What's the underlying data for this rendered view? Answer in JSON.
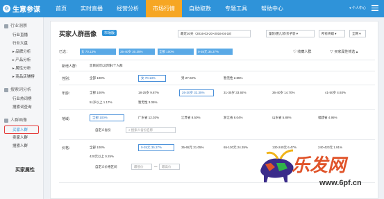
{
  "app": {
    "logo": "生意参谋"
  },
  "nav": [
    "首页",
    "实时直播",
    "经营分析",
    "市场行情",
    "自助取数",
    "专题工具",
    "帮助中心"
  ],
  "user": "个人中心",
  "sidebar": {
    "sections": [
      {
        "title": "行业洞察",
        "items": [
          "行业直播",
          "行业大盘",
          "品牌分析",
          "产品分析",
          "属性分析",
          "商品店铺榜"
        ]
      },
      {
        "title": "搜索词分析",
        "items": [
          "行业热词榜",
          "搜索词查询"
        ]
      },
      {
        "title": "人群画像",
        "items": [
          "买家人群",
          "卖家人群",
          "搜索人群"
        ]
      }
    ],
    "active": "买家人群"
  },
  "page": {
    "title": "买家人群画像",
    "badge": "市场版",
    "date_range": "最近30天（2016-03-20~2016-04-18）",
    "category": "童装/婴儿装/亲子装",
    "terminal": "所有终端",
    "region": "全网"
  },
  "toolbar": {
    "label": "已选：",
    "chips": [
      "女 70.13%",
      "35-40岁 30.35%",
      "全部 100%",
      "0-35元 35.37%"
    ],
    "collect": "收藏人群",
    "filter": "买家属性筛选"
  },
  "new_people": {
    "label": "新增人群：",
    "text": "您目前可以新增0个人群"
  },
  "gender": {
    "label": "性别：",
    "items": [
      "全部 100%",
      "女 70.13%",
      "男 27.02%",
      "暂无性 2.85%"
    ],
    "selected": 1
  },
  "age": {
    "label": "年龄：",
    "items": [
      "全部 100%",
      "18-25岁 9.87%",
      "26-30岁 32.35%",
      "31-35岁 33.92%",
      "36-40岁 14.70%",
      "41-50岁 4.93%"
    ],
    "items2": [
      "51岁以上 1.17%",
      "暂无性 3.05%"
    ],
    "selected": 2
  },
  "region": {
    "label": "地域：",
    "items": [
      "全部 100%",
      "广东省 12.03%",
      "江苏省 8.50%",
      "浙江省 8.04%",
      "山东省 5.88%",
      "福建省 4.95%"
    ],
    "custom_label": "自定义省份",
    "custom_placeholder": "搜索人省份名称",
    "selected": 0
  },
  "price": {
    "label": "价格：",
    "items": [
      "全部 100%",
      "0-35元 35.37%",
      "35-65元 31.05%",
      "65-130元 24.35%",
      "130-240元 6.47%",
      "240-420元 1.91%"
    ],
    "items2": [
      "420元以上 0.25%"
    ],
    "custom_label": "自定义价格区间",
    "min_placeholder": "最低价",
    "max_placeholder": "最高价",
    "selected": 1
  },
  "bottom": {
    "title": "买家属性"
  },
  "watermark": {
    "text": "乐发网",
    "url": "www.6pf.cn"
  }
}
